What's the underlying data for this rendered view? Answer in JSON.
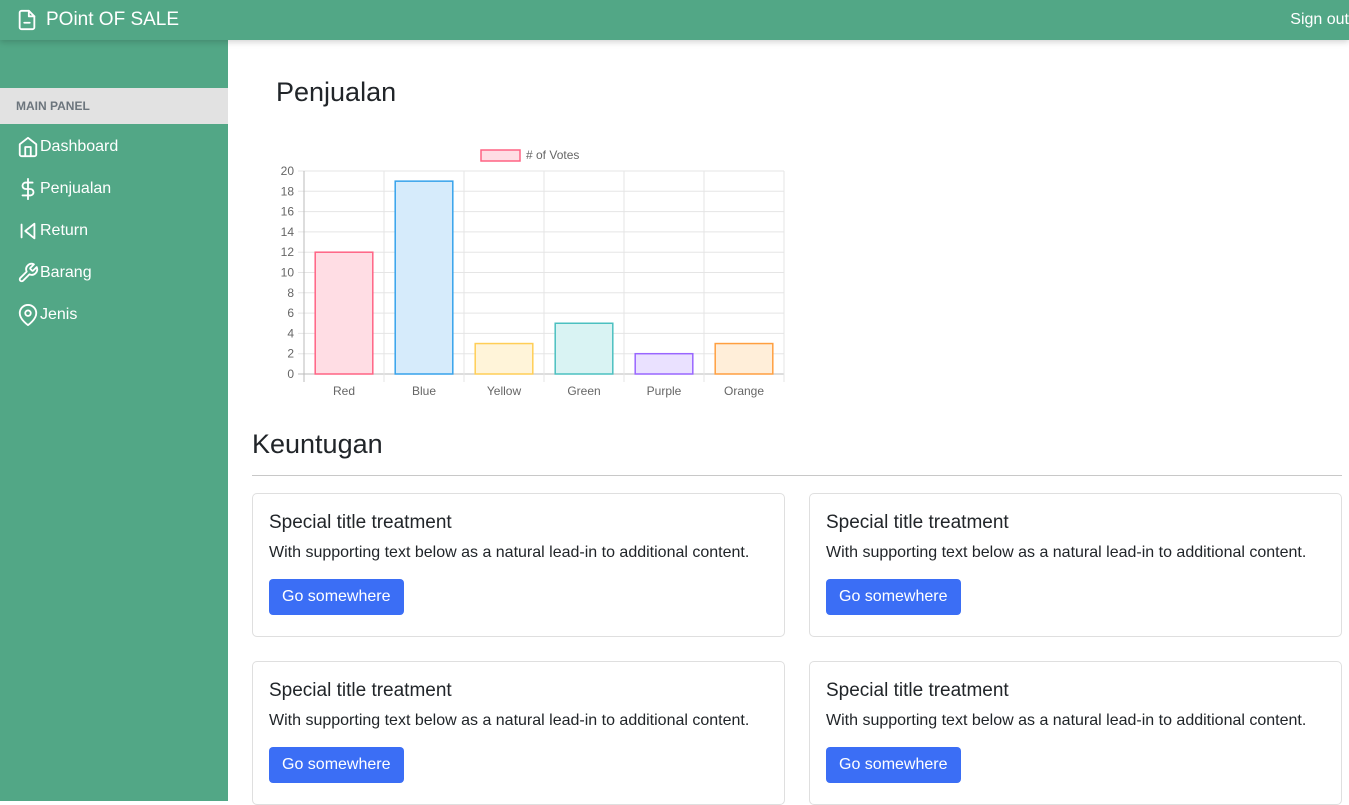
{
  "app": {
    "brand": "POint OF SALE",
    "signout": "Sign out"
  },
  "sidebar": {
    "section": "MAIN PANEL",
    "items": [
      {
        "label": "Dashboard",
        "icon": "home-icon"
      },
      {
        "label": "Penjualan",
        "icon": "dollar-icon"
      },
      {
        "label": "Return",
        "icon": "skip-back-icon"
      },
      {
        "label": "Barang",
        "icon": "tool-icon"
      },
      {
        "label": "Jenis",
        "icon": "map-pin-icon"
      }
    ]
  },
  "main": {
    "title": "Penjualan",
    "subtitle": "Keuntugan",
    "cards": [
      {
        "title": "Special title treatment",
        "text": "With supporting text below as a natural lead-in to additional content.",
        "button": "Go somewhere"
      },
      {
        "title": "Special title treatment",
        "text": "With supporting text below as a natural lead-in to additional content.",
        "button": "Go somewhere"
      },
      {
        "title": "Special title treatment",
        "text": "With supporting text below as a natural lead-in to additional content.",
        "button": "Go somewhere"
      },
      {
        "title": "Special title treatment",
        "text": "With supporting text below as a natural lead-in to additional content.",
        "button": "Go somewhere"
      }
    ]
  },
  "colors": {
    "sidebar": "#52a786",
    "button": "#3b6ef5"
  },
  "chart_data": {
    "type": "bar",
    "categories": [
      "Red",
      "Blue",
      "Yellow",
      "Green",
      "Purple",
      "Orange"
    ],
    "series": [
      {
        "name": "# of Votes",
        "values": [
          12,
          19,
          3,
          5,
          2,
          3
        ]
      }
    ],
    "fills": [
      "#ffdde4",
      "#d6ebfb",
      "#fff4d9",
      "#d9f3f3",
      "#eae1ff",
      "#ffeed9"
    ],
    "strokes": [
      "#ff6384",
      "#36a2eb",
      "#ffce56",
      "#4bc0c0",
      "#9966ff",
      "#ff9f40"
    ],
    "yticks": [
      "0",
      "2",
      "4",
      "6",
      "8",
      "10",
      "12",
      "14",
      "16",
      "18",
      "20"
    ],
    "ylim": [
      0,
      20
    ],
    "grid": true,
    "legend": "top"
  }
}
